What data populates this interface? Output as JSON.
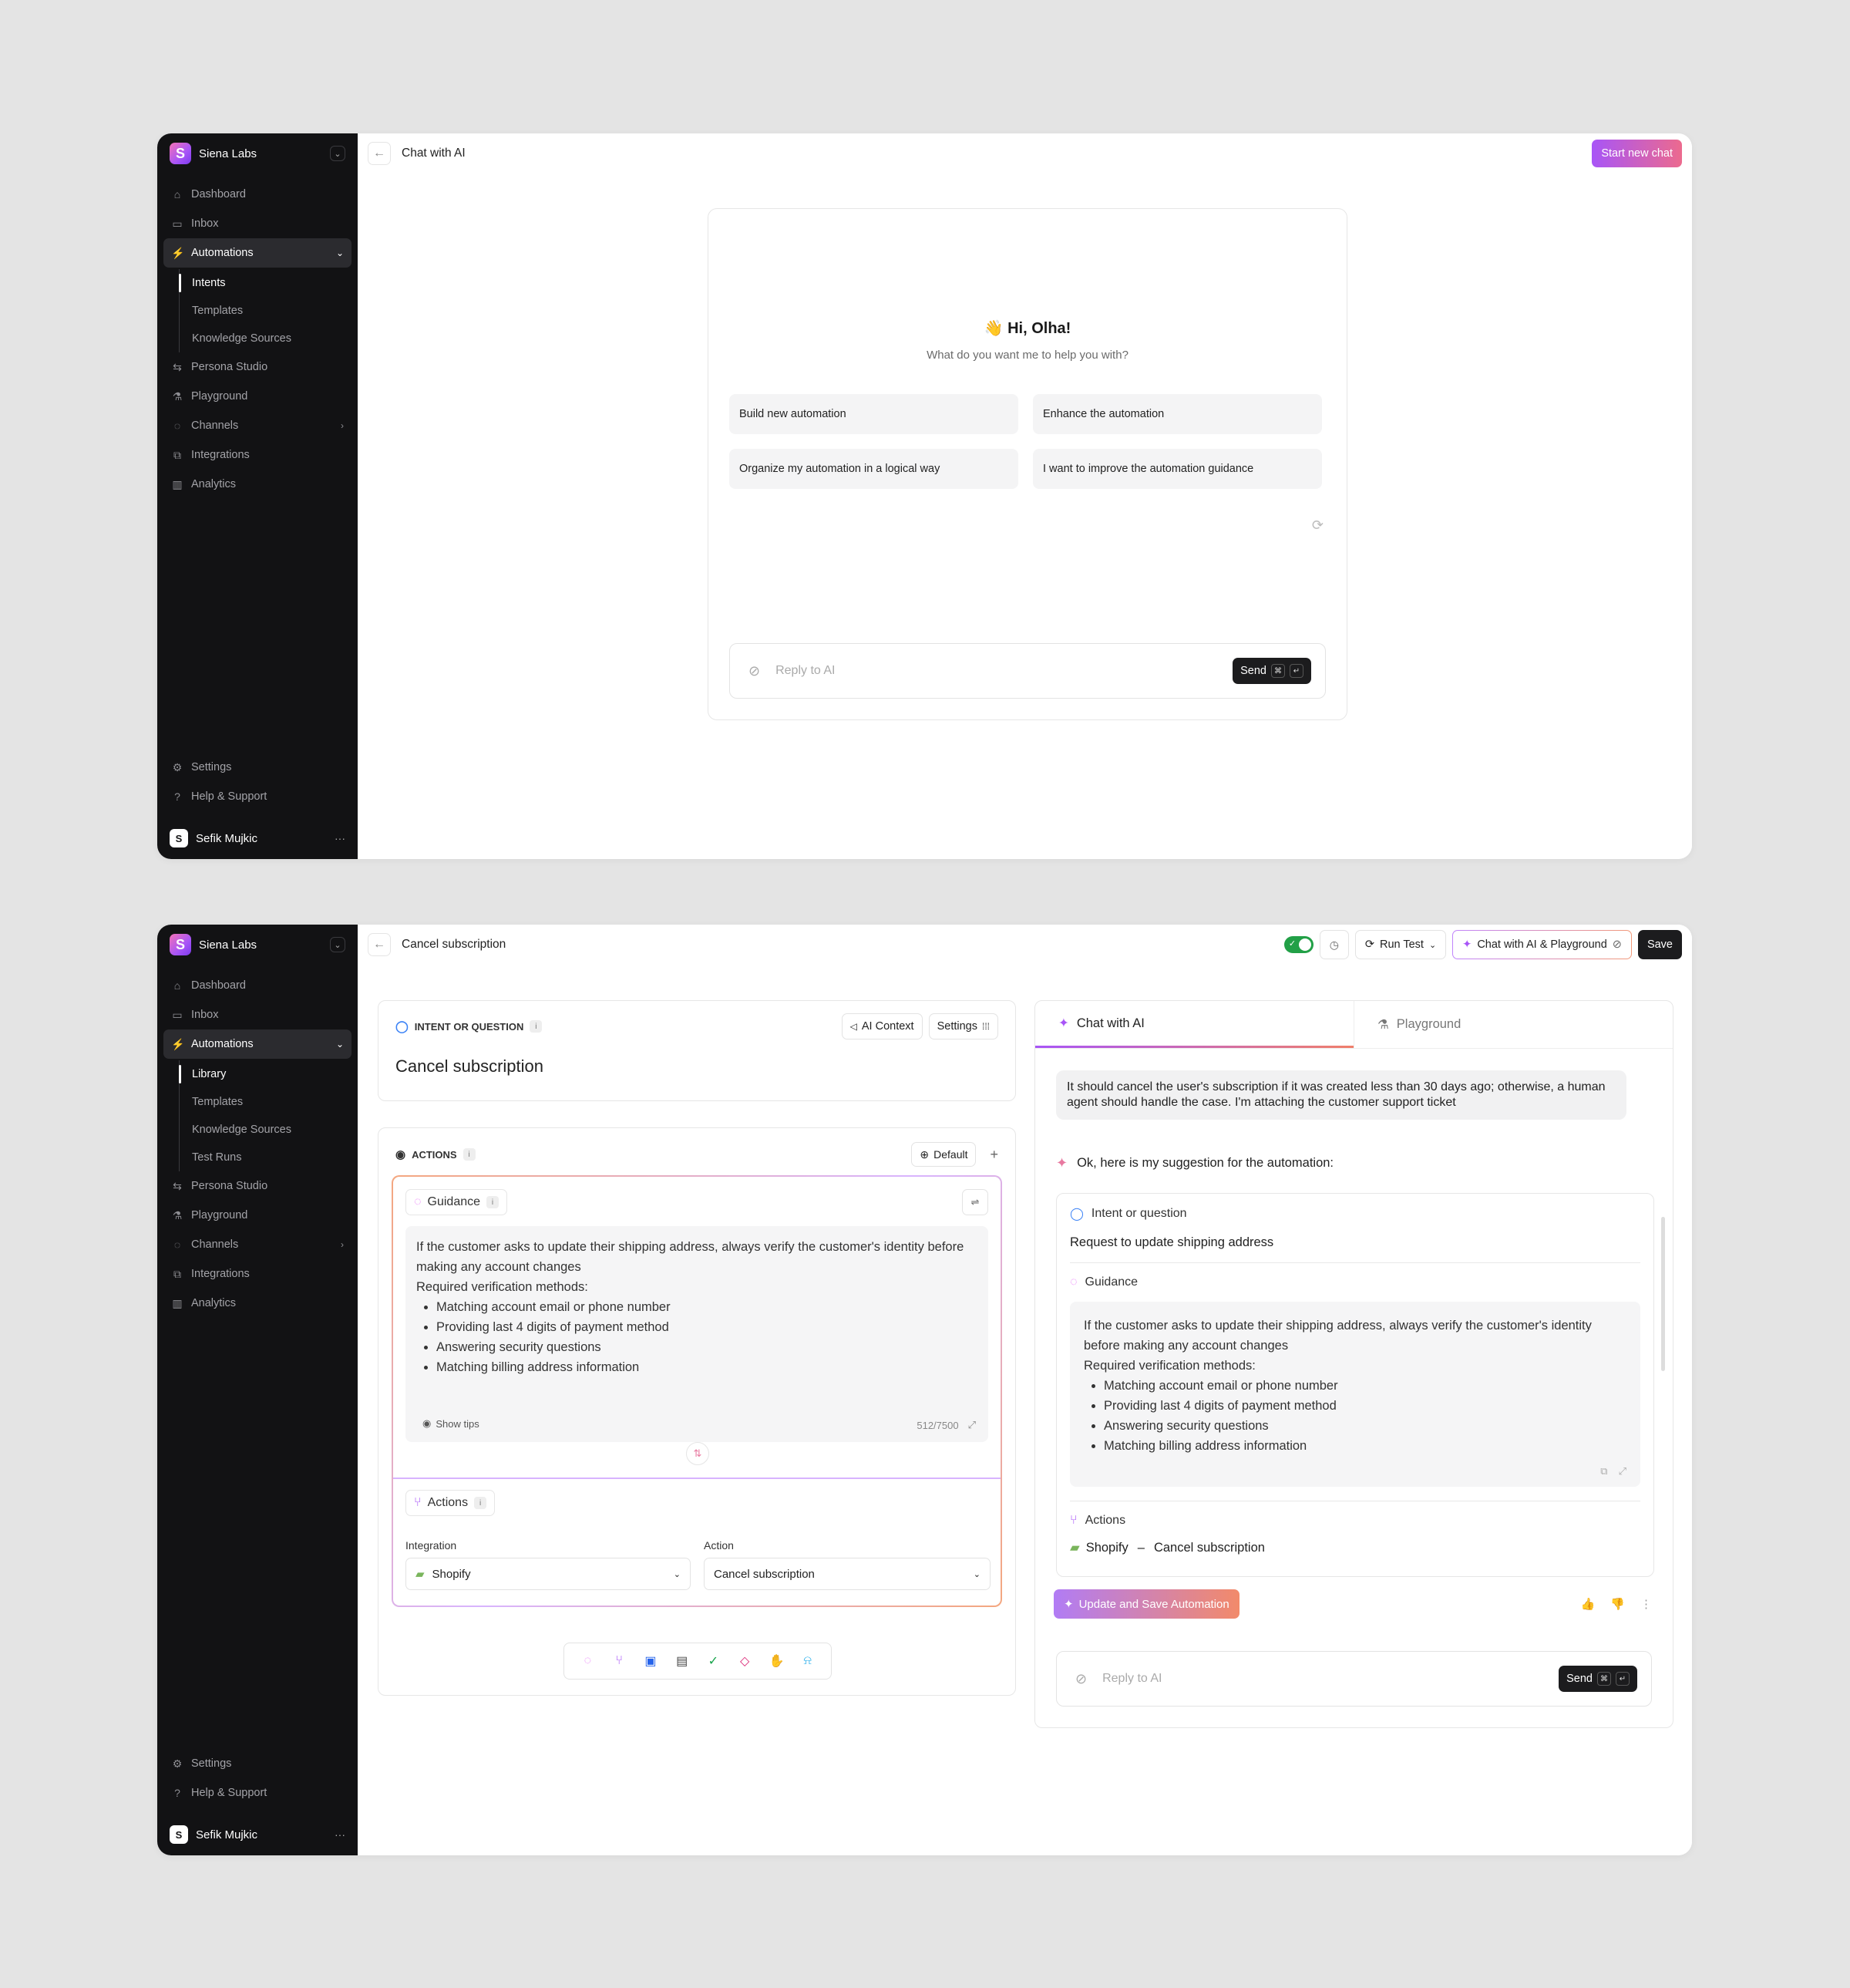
{
  "sidebar": {
    "workspace": "Siena Labs",
    "logo_letter": "S",
    "nav": [
      "Dashboard",
      "Inbox",
      "Automations",
      "Persona Studio",
      "Playground",
      "Channels",
      "Integrations",
      "Analytics"
    ],
    "settings": "Settings",
    "help": "Help & Support",
    "user": "Sefik Mujkic",
    "user_initial": "S"
  },
  "screen1": {
    "sub": [
      "Intents",
      "Templates",
      "Knowledge Sources"
    ],
    "title": "Chat with AI",
    "start_button": "Start new chat",
    "greeting": "👋 Hi, Olha!",
    "subtitle": "What do you want me to help you with?",
    "suggestions": [
      "Build new automation",
      "Enhance the automation",
      "Organize my automation in a logical way",
      "I want to improve the automation guidance"
    ],
    "reply_placeholder": "Reply to AI",
    "send": "Send"
  },
  "screen2": {
    "sub": [
      "Library",
      "Templates",
      "Knowledge Sources",
      "Test Runs"
    ],
    "title": "Cancel subscription",
    "run_test": "Run Test",
    "chat_playground": "Chat with AI  & Playground",
    "save": "Save",
    "intent": {
      "label": "INTENT OR QUESTION",
      "ai_context": "AI Context",
      "settings": "Settings",
      "value": "Cancel subscription"
    },
    "actions_card": {
      "label": "ACTIONS",
      "default": "Default",
      "guidance_label": "Guidance",
      "guidance_intro": "If the customer asks to update their shipping address, always verify the customer's identity before making any account changes",
      "guidance_req": "Required verification methods:",
      "guidance_items": [
        "Matching account email or phone number",
        "Providing last 4 digits of payment method",
        "Answering security questions",
        "Matching billing address information"
      ],
      "show_tips": "Show tips",
      "counter": "512/7500",
      "actions_label": "Actions",
      "integration_label": "Integration",
      "integration_value": "Shopify",
      "action_label": "Action",
      "action_value": "Cancel subscription"
    },
    "chat": {
      "tab_chat": "Chat with AI",
      "tab_playground": "Playground",
      "user_msg": "It should cancel the user's subscription if it was created less than 30 days ago; otherwise, a human agent should handle the case. I'm attaching the customer support ticket",
      "ai_msg": "Ok, here is my suggestion for the automation:",
      "intent_label": "Intent or question",
      "intent_value": "Request to update shipping address",
      "guidance_label": "Guidance",
      "actions_label": "Actions",
      "action_integration": "Shopify",
      "action_sep": "–",
      "action_value": "Cancel subscription",
      "update_button": "Update and Save Automation",
      "reply_placeholder": "Reply to AI",
      "send": "Send"
    }
  },
  "colors": {
    "accent_purple": "#a855f7",
    "accent_orange": "#f07f6a",
    "toggle_green": "#22a047",
    "sidebar_bg": "#121214"
  }
}
